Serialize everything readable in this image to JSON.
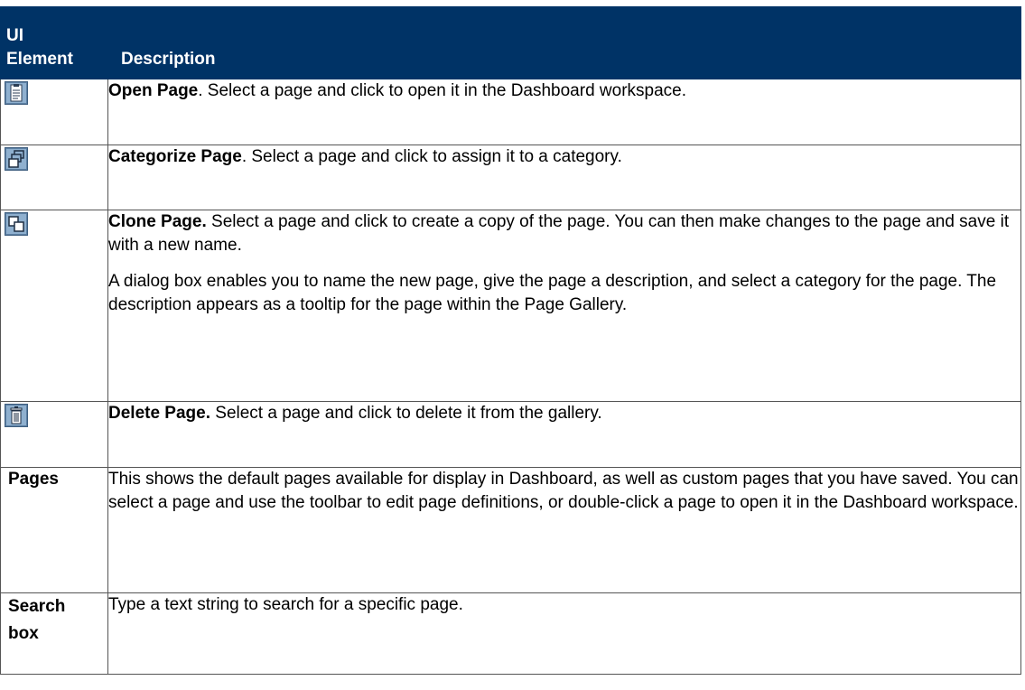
{
  "header": {
    "col1_line1": "UI",
    "col1_line2": "Element",
    "col2": "Description"
  },
  "rows": [
    {
      "icon": "open-page-icon",
      "term": "Open Page",
      "desc": ". Select a page and click to open it in the Dashboard workspace."
    },
    {
      "icon": "categorize-page-icon",
      "term": "Categorize Page",
      "desc": ". Select a page and click to assign it to a category."
    },
    {
      "icon": "clone-page-icon",
      "term": "Clone Page.",
      "desc": " Select a page and click to create a copy of the page. You can then make changes to the page and save it with a new name.",
      "desc2": "A dialog box enables you to name the new page, give the page a description, and select a category for the page. The description appears as a tooltip for the page within the Page Gallery."
    },
    {
      "icon": "delete-page-icon",
      "term": "Delete Page.",
      "desc": " Select a page and click to delete it from the gallery."
    },
    {
      "element": "Pages",
      "desc": "This shows the default pages available for display in Dashboard, as well as custom pages that you have saved. You can select a page and use the toolbar to edit page definitions, or double-click a page to open it in the Dashboard workspace."
    },
    {
      "element": "Search box",
      "desc": "Type a text string to search for a specific page."
    }
  ]
}
